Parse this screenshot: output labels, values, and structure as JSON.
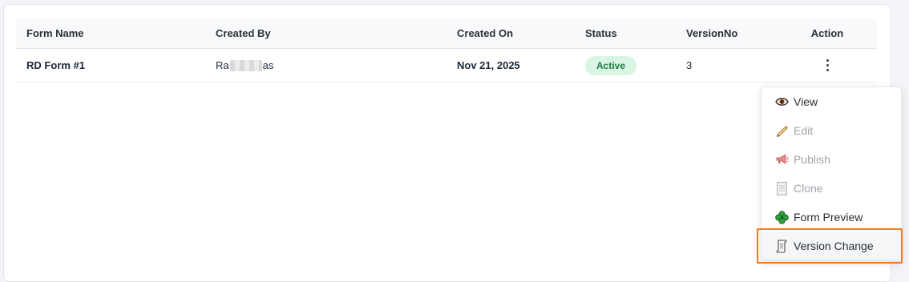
{
  "table": {
    "headers": {
      "form_name": "Form Name",
      "created_by": "Created By",
      "created_on": "Created On",
      "status": "Status",
      "version_no": "VersionNo",
      "action": "Action"
    },
    "rows": [
      {
        "form_name": "RD Form #1",
        "created_by_prefix": "Ra",
        "created_by_suffix": "as",
        "created_on": "Nov 21, 2025",
        "status": "Active",
        "version_no": "3"
      }
    ]
  },
  "action_menu": {
    "items": [
      {
        "label": "View",
        "icon": "eye-icon",
        "enabled": true
      },
      {
        "label": "Edit",
        "icon": "pencil-icon",
        "enabled": false
      },
      {
        "label": "Publish",
        "icon": "megaphone-icon",
        "enabled": false
      },
      {
        "label": "Clone",
        "icon": "document-icon",
        "enabled": false
      },
      {
        "label": "Form Preview",
        "icon": "clover-icon",
        "enabled": true
      },
      {
        "label": "Version Change",
        "icon": "scroll-icon",
        "enabled": true,
        "highlighted": true
      }
    ]
  },
  "colors": {
    "status_active_bg": "#d9f6e5",
    "status_active_text": "#1f7a47",
    "highlight_border": "#f07a2a"
  }
}
